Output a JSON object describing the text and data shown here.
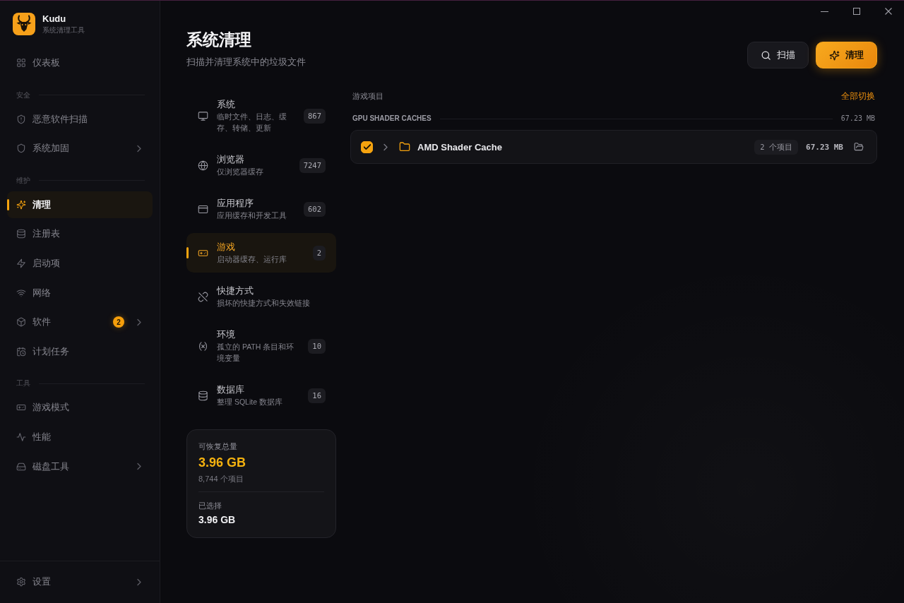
{
  "app": {
    "name": "Kudu",
    "tagline": "系统清理工具"
  },
  "sidebar": {
    "groups": [
      {
        "items": [
          {
            "label": "仪表板",
            "selected": false,
            "submenu": false
          }
        ]
      },
      {
        "heading": "安全",
        "items": [
          {
            "label": "恶意软件扫描",
            "selected": false,
            "submenu": false
          },
          {
            "label": "系统加固",
            "selected": false,
            "submenu": true
          }
        ]
      },
      {
        "heading": "维护",
        "items": [
          {
            "label": "清理",
            "selected": true,
            "submenu": false
          },
          {
            "label": "注册表",
            "selected": false,
            "submenu": false
          },
          {
            "label": "启动项",
            "selected": false,
            "submenu": false
          },
          {
            "label": "网络",
            "selected": false,
            "submenu": false
          },
          {
            "label": "软件",
            "selected": false,
            "submenu": true,
            "badge": "2"
          },
          {
            "label": "计划任务",
            "selected": false,
            "submenu": false
          }
        ]
      },
      {
        "heading": "工具",
        "items": [
          {
            "label": "游戏模式",
            "selected": false,
            "submenu": false
          },
          {
            "label": "性能",
            "selected": false,
            "submenu": false
          },
          {
            "label": "磁盘工具",
            "selected": false,
            "submenu": true
          }
        ]
      }
    ],
    "footer": {
      "label": "设置",
      "selected": false,
      "submenu": true
    }
  },
  "header": {
    "title": "系统清理",
    "subtitle": "扫描并清理系统中的垃圾文件",
    "actions": [
      {
        "label": "扫描",
        "kind": "secondary"
      },
      {
        "label": "清理",
        "kind": "primary"
      }
    ]
  },
  "categories": [
    {
      "title": "系统",
      "description": "临时文件、日志、缓存、转储、更新",
      "count": "867",
      "selected": false
    },
    {
      "title": "浏览器",
      "description": "仅浏览器缓存",
      "count": "7247",
      "selected": false
    },
    {
      "title": "应用程序",
      "description": "应用缓存和开发工具",
      "count": "602",
      "selected": false
    },
    {
      "title": "游戏",
      "description": "启动器缓存、运行库",
      "count": "2",
      "selected": true
    },
    {
      "title": "快捷方式",
      "description": "损坏的快捷方式和失效链接",
      "selected": false
    },
    {
      "title": "环境",
      "description": "孤立的 PATH 条目和环境变量",
      "count": "10",
      "selected": false
    },
    {
      "title": "数据库",
      "description": "整理 SQLite 数据库",
      "count": "16",
      "selected": false
    }
  ],
  "summary": {
    "label": "可恢复总量",
    "total": "3.96 GB",
    "items": "8,744 个项目",
    "selected_label": "已选择",
    "selected_total": "3.96 GB"
  },
  "content": {
    "section_label": "游戏项目",
    "toggle_all": "全部切换",
    "groups": [
      {
        "name": "GPU SHADER CACHES",
        "size": "67.23 MB",
        "entries": [
          {
            "name": "AMD Shader Cache",
            "checked": true,
            "expanded": false,
            "count": "2 个项目",
            "size": "67.23 MB"
          }
        ]
      }
    ]
  }
}
